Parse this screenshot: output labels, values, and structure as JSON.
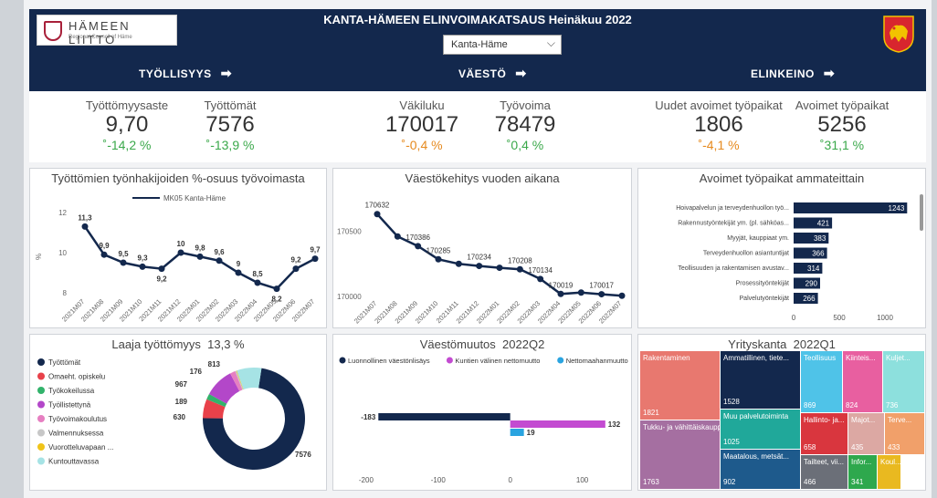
{
  "header": {
    "logo_name": "HÄMEEN LIITTO",
    "logo_sub": "Regional Council of Häme",
    "title": "KANTA-HÄMEEN ELINVOIMAKATSAUS  Heinäkuu 2022",
    "region": "Kanta-Häme",
    "nav": [
      "TYÖLLISYYS",
      "VÄESTÖ",
      "ELINKEINO"
    ]
  },
  "kpis": [
    {
      "label": "Työttömyysaste",
      "value": "9,70",
      "change": "-14,2 %",
      "trend": "up"
    },
    {
      "label": "Työttömät",
      "value": "7576",
      "change": "-13,9 %",
      "trend": "up"
    },
    {
      "label": "Väkiluku",
      "value": "170017",
      "change": "-0,4 %",
      "trend": "down"
    },
    {
      "label": "Työvoima",
      "value": "78479",
      "change": "0,4 %",
      "trend": "up"
    },
    {
      "label": "Uudet avoimet työpaikat",
      "value": "1806",
      "change": "-4,1 %",
      "trend": "down"
    },
    {
      "label": "Avoimet työpaikat",
      "value": "5256",
      "change": "31,1 %",
      "trend": "up"
    }
  ],
  "colors": {
    "navy": "#13284d",
    "up": "#3aa84a",
    "down": "#e68a1f"
  },
  "chart_data": [
    {
      "type": "line",
      "title": "Työttömien työnhakijoiden %-osuus työvoimasta",
      "series_name": "MK05 Kanta-Häme",
      "ylabel": "%",
      "x": [
        "2021M07",
        "2021M08",
        "2021M09",
        "2021M10",
        "2021M11",
        "2021M12",
        "2022M01",
        "2022M02",
        "2022M03",
        "2022M04",
        "2022M05",
        "2022M06",
        "2022M07"
      ],
      "y": [
        11.3,
        9.9,
        9.5,
        9.3,
        9.2,
        10,
        9.8,
        9.6,
        9,
        8.5,
        8.2,
        9.2,
        9.7
      ],
      "labels": [
        "11,3",
        "9,9",
        "9,5",
        "9,3",
        "9,2",
        "10",
        "9,8",
        "9,6",
        "9",
        "8,5",
        "8,2",
        "9,2",
        "9,7"
      ],
      "yticks": [
        "12",
        "10",
        "8"
      ],
      "ylim": [
        8,
        12
      ]
    },
    {
      "type": "line",
      "title": "Väestökehitys vuoden aikana",
      "x": [
        "2021M07",
        "2021M08",
        "2021M09",
        "2021M10",
        "2021M11",
        "2021M12",
        "2022M01",
        "2022M02",
        "2022M03",
        "2022M04",
        "2022M05",
        "2022M06",
        "2022M07"
      ],
      "y": [
        170632,
        170460,
        170386,
        170285,
        170250,
        170234,
        170220,
        170208,
        170134,
        170019,
        170030,
        170017,
        170005
      ],
      "labels": [
        "170632",
        "",
        "170386",
        "170285",
        "",
        "170234",
        "",
        "170208",
        "170134",
        "170019",
        "",
        "170017",
        ""
      ],
      "yticks": [
        "170500",
        "170000"
      ],
      "ylim": [
        170000,
        170700
      ]
    },
    {
      "type": "bar",
      "orientation": "horizontal",
      "title": "Avoimet työpaikat ammateittain",
      "categories": [
        "Hoivapalvelun ja terveydenhuollon työ...",
        "Rakennustyöntekijät ym. (pl. sähköas...",
        "Myyjät, kauppiaat ym.",
        "Terveydenhuollon asiantuntijat",
        "Teollisuuden ja rakentamisen avustav...",
        "Prosessityöntekijät",
        "Palvelutyöntekijät"
      ],
      "values": [
        1243,
        421,
        383,
        366,
        314,
        290,
        266
      ],
      "xticks": [
        "0",
        "500",
        "1000"
      ],
      "xlim": [
        0,
        1300
      ]
    },
    {
      "type": "pie",
      "title": "Laaja työttömyys",
      "headline": "13,3 %",
      "categories": [
        "Työttömät",
        "Omaeht. opiskelu",
        "Työkokeilussa",
        "Työllistettynä",
        "Työvoimakoulutus",
        "Valmennuksessa",
        "Vuorotteluvapaan ...",
        "Kuntouttavassa"
      ],
      "values": [
        7576,
        630,
        189,
        967,
        176,
        40,
        20,
        813
      ],
      "labels": [
        "7576",
        "630",
        "189",
        "967",
        "176",
        "",
        "",
        "813"
      ],
      "colors": [
        "#13284d",
        "#e8414a",
        "#32b36b",
        "#b347c9",
        "#e67fc1",
        "#c7c7c7",
        "#f0c419",
        "#a6e3e5"
      ]
    },
    {
      "type": "bar",
      "orientation": "horizontal",
      "title": "Väestömuutos",
      "period": "2022Q2",
      "series": [
        {
          "name": "Luonnollinen väestönlisäys",
          "value": -183,
          "label": "-183",
          "color": "#13284d"
        },
        {
          "name": "Kuntien välinen nettomuutto",
          "value": 132,
          "label": "132",
          "color": "#c34bd1"
        },
        {
          "name": "Nettomaahanmuutto",
          "value": 19,
          "label": "19",
          "color": "#2aa4e0"
        }
      ],
      "xticks": [
        "-200",
        "-100",
        "0",
        "100"
      ],
      "xlim": [
        -210,
        150
      ]
    },
    {
      "type": "treemap",
      "title": "Yrityskanta",
      "period": "2022Q1",
      "items": [
        {
          "label": "Rakentaminen",
          "value": "1821",
          "color": "#e8786f"
        },
        {
          "label": "Tukku- ja vähittäiskaupp...",
          "value": "1763",
          "color": "#a56fa1"
        },
        {
          "label": "Ammatillinen, tiete...",
          "value": "1528",
          "color": "#13284d"
        },
        {
          "label": "Muu palvelutoiminta",
          "value": "1025",
          "color": "#20a89a"
        },
        {
          "label": "Maatalous, metsät...",
          "value": "902",
          "color": "#1e5a8c"
        },
        {
          "label": "Teollisuus",
          "value": "869",
          "color": "#4fc3e8"
        },
        {
          "label": "Kiinteis...",
          "value": "824",
          "color": "#e85fa0"
        },
        {
          "label": "Kuljet...",
          "value": "736",
          "color": "#8de0dd"
        },
        {
          "label": "Hallinto- ja...",
          "value": "658",
          "color": "#d9363e"
        },
        {
          "label": "Majot...",
          "value": "435",
          "color": "#dca8a3"
        },
        {
          "label": "Terve...",
          "value": "433",
          "color": "#f1a06a"
        },
        {
          "label": "Tailteet, vii...",
          "value": "466",
          "color": "#6b6f78"
        },
        {
          "label": "Infor...",
          "value": "341",
          "color": "#2ea84d"
        },
        {
          "label": "Koul...",
          "value": "",
          "color": "#e9b920"
        }
      ]
    }
  ]
}
